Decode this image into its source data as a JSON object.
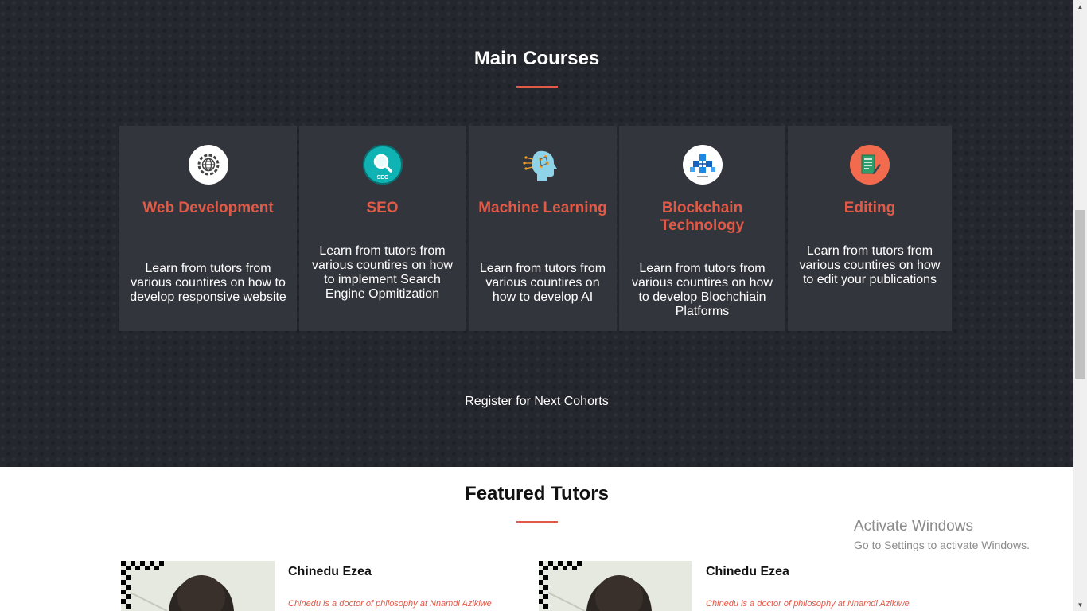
{
  "courses": {
    "title": "Main Courses",
    "cards": [
      {
        "title": "Web Development",
        "description": "Learn from tutors from various countires on how to develop responsive website",
        "icon": "gear-globe-icon"
      },
      {
        "title": "SEO",
        "description": "Learn from tutors from various countires on how to implement Search Engine Opmitization",
        "icon": "seo-magnifier-icon"
      },
      {
        "title": "Machine Learning",
        "description": "Learn from tutors from various countires on how to develop AI",
        "icon": "ai-head-icon"
      },
      {
        "title": "Blockchain Technology",
        "description": "Learn from tutors from various countires on how to develop Blochchiain Platforms",
        "icon": "blockchain-cubes-icon"
      },
      {
        "title": "Editing",
        "description": "Learn from tutors from various countires on how to edit your publications",
        "icon": "document-pen-icon"
      }
    ],
    "register_label": "Register for Next Cohorts"
  },
  "tutors": {
    "title": "Featured Tutors",
    "items": [
      {
        "name": "Chinedu Ezea",
        "bio": "Chinedu is a doctor of philosophy at Nnamdi Azikiwe"
      },
      {
        "name": "Chinedu Ezea",
        "bio": "Chinedu is a doctor of philosophy at Nnamdi Azikiwe"
      }
    ]
  },
  "watermark": {
    "line1": "Activate Windows",
    "line2": "Go to Settings to activate Windows."
  },
  "colors": {
    "dark_bg": "#25272e",
    "card_bg": "#33353c",
    "accent": "#e05a47"
  }
}
